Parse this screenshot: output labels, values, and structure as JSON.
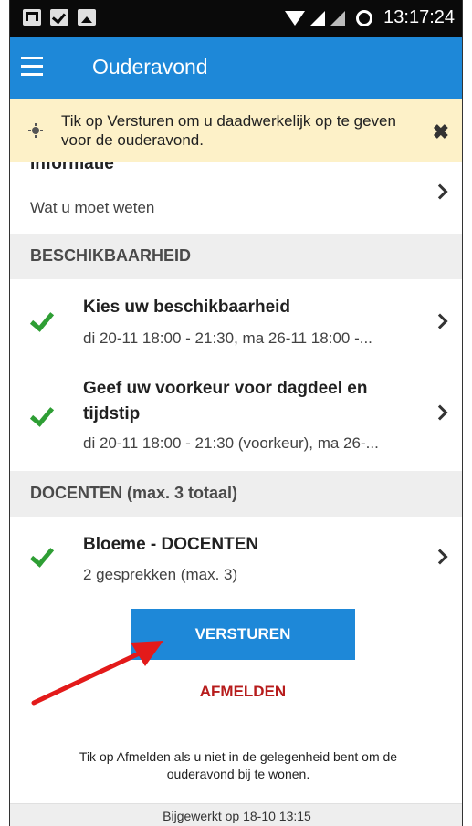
{
  "status_bar": {
    "time": "13:17:24"
  },
  "app_bar": {
    "title": "Ouderavond"
  },
  "banner": {
    "text": "Tik op Versturen om u daadwerkelijk op te geven voor de ouderavond."
  },
  "info_row": {
    "title": "Informatie",
    "subtitle": "Wat u moet weten"
  },
  "sections": {
    "availability": "BESCHIKBAARHEID",
    "teachers": "DOCENTEN (max. 3 totaal)"
  },
  "availability_items": [
    {
      "title": "Kies uw beschikbaarheid",
      "subtitle": "di 20-11 18:00 - 21:30, ma 26-11 18:00 -..."
    },
    {
      "title": "Geef uw voorkeur voor dagdeel en tijdstip",
      "subtitle": "di 20-11 18:00 - 21:30 (voorkeur), ma 26-..."
    }
  ],
  "teacher_items": [
    {
      "title": "Bloeme - DOCENTEN",
      "subtitle": "2 gesprekken (max. 3)"
    }
  ],
  "actions": {
    "send_label": "VERSTUREN",
    "cancel_label": "AFMELDEN"
  },
  "hint": "Tik op Afmelden als u niet in de gelegenheid bent om de ouderavond bij te wonen.",
  "footer": "Bijgewerkt op 18-10 13:15",
  "colors": {
    "primary": "#1e88d8",
    "banner": "#fdf1c8",
    "check": "#2e9e34",
    "cancel": "#b71c1c",
    "section": "#eeeeee"
  }
}
